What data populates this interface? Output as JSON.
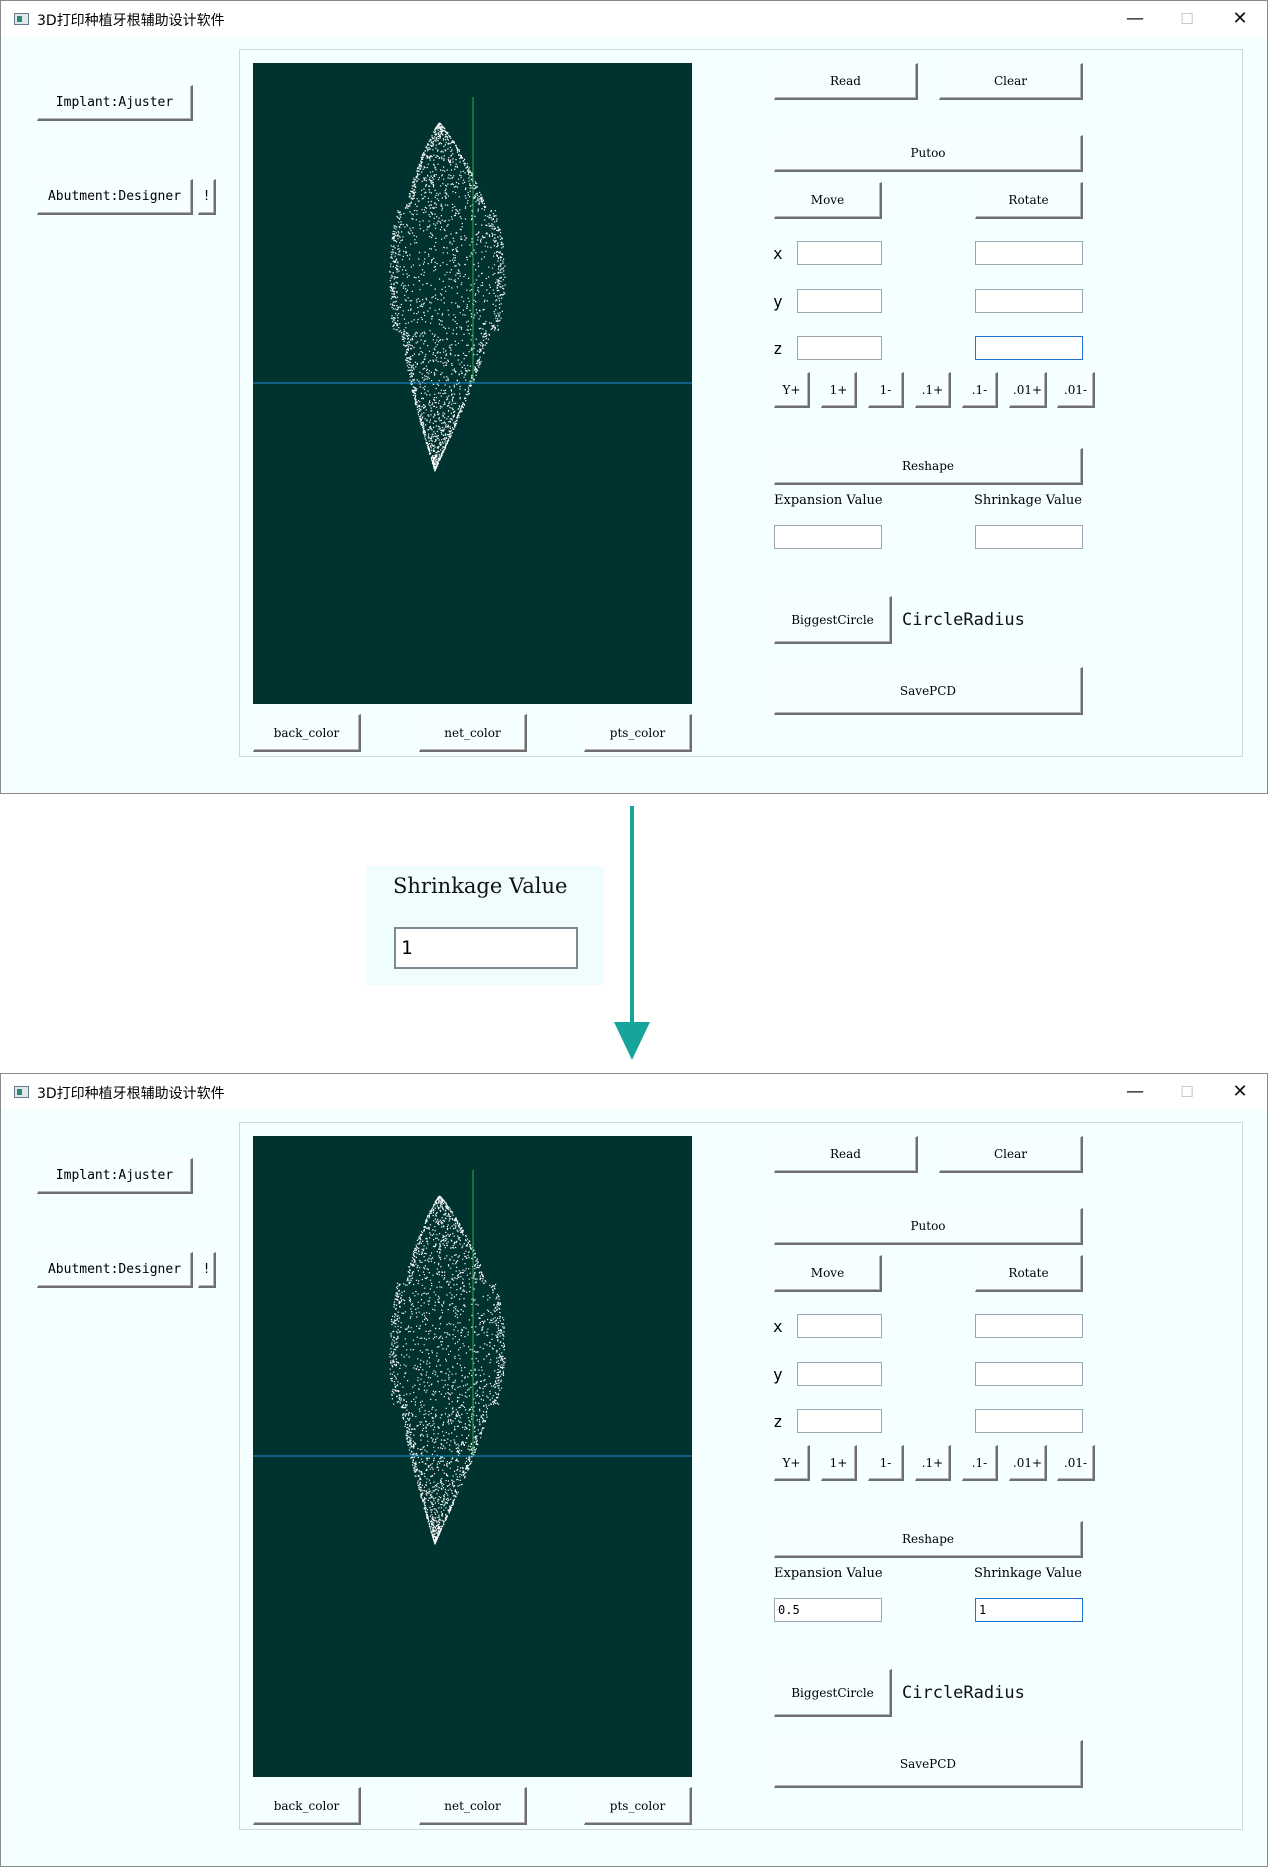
{
  "windows": [
    {
      "title": "3D打印种植牙根辅助设计软件",
      "window_controls": {
        "minimize": "—",
        "maximize": "☐",
        "close": "✕"
      },
      "left_buttons": {
        "implant": "Implant:Ajuster",
        "abutment": "Abutment:Designer",
        "exclaim": "!"
      },
      "toolbar": {
        "read": "Read",
        "clear": "Clear",
        "putoo": "Putoo",
        "move": "Move",
        "rotate": "Rotate"
      },
      "axes": {
        "x": "x",
        "y": "y",
        "z": "z"
      },
      "coord_fields": {
        "move_x": "",
        "move_y": "",
        "move_z": "",
        "rotate_x": "",
        "rotate_y": "",
        "rotate_z": ""
      },
      "step_buttons": [
        "Y+",
        "1+",
        "1-",
        ".1+",
        ".1-",
        ".01+",
        ".01-"
      ],
      "reshape": {
        "button": "Reshape",
        "expansion_label": "Expansion Value",
        "shrinkage_label": "Shrinkage Value",
        "expansion_value": "",
        "shrinkage_value": ""
      },
      "biggest_circle": "BiggestCircle",
      "circle_radius_label": "CircleRadius",
      "save_pcd": "SavePCD",
      "color_buttons": {
        "back": "back_color",
        "net": "net_color",
        "pts": "pts_color"
      },
      "focused_field": "rotate_z",
      "colors": {
        "viewport_bg": "#003330",
        "points": "#ffffff",
        "axis_green": "#2bb03a",
        "axis_blue": "#1d8fd8"
      }
    },
    {
      "title": "3D打印种植牙根辅助设计软件",
      "window_controls": {
        "minimize": "—",
        "maximize": "☐",
        "close": "✕"
      },
      "left_buttons": {
        "implant": "Implant:Ajuster",
        "abutment": "Abutment:Designer",
        "exclaim": "!"
      },
      "toolbar": {
        "read": "Read",
        "clear": "Clear",
        "putoo": "Putoo",
        "move": "Move",
        "rotate": "Rotate"
      },
      "axes": {
        "x": "x",
        "y": "y",
        "z": "z"
      },
      "coord_fields": {
        "move_x": "",
        "move_y": "",
        "move_z": "",
        "rotate_x": "",
        "rotate_y": "",
        "rotate_z": ""
      },
      "step_buttons": [
        "Y+",
        "1+",
        "1-",
        ".1+",
        ".1-",
        ".01+",
        ".01-"
      ],
      "reshape": {
        "button": "Reshape",
        "expansion_label": "Expansion Value",
        "shrinkage_label": "Shrinkage Value",
        "expansion_value": "0.5",
        "shrinkage_value": "1"
      },
      "biggest_circle": "BiggestCircle",
      "circle_radius_label": "CircleRadius",
      "save_pcd": "SavePCD",
      "color_buttons": {
        "back": "back_color",
        "net": "net_color",
        "pts": "pts_color"
      },
      "focused_field": "shrinkage",
      "colors": {
        "viewport_bg": "#003330",
        "points": "#ffffff",
        "axis_green": "#2bb03a",
        "axis_blue": "#1d8fd8"
      }
    }
  ],
  "zoom_callout": {
    "label": "Shrinkage Value",
    "value": "1"
  },
  "arrow_color": "#16a59a"
}
